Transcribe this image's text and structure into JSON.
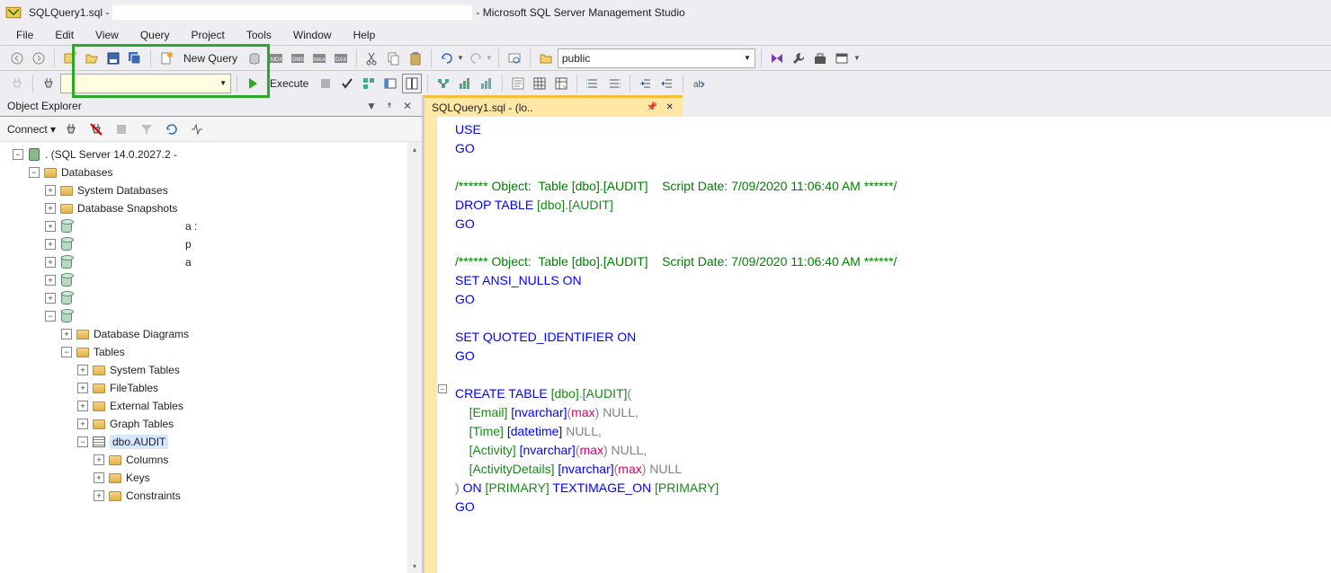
{
  "title": {
    "prefix": "SQLQuery1.sql -",
    "suffix": "- Microsoft SQL Server Management Studio"
  },
  "menu": [
    "File",
    "Edit",
    "View",
    "Query",
    "Project",
    "Tools",
    "Window",
    "Help"
  ],
  "toolbar1": {
    "new_query": "New Query",
    "combo_value": "public"
  },
  "toolbar2": {
    "execute": "Execute"
  },
  "oe": {
    "title": "Object Explorer",
    "connect": "Connect",
    "tree": {
      "server": ". (SQL Server 14.0.2027.2 -",
      "databases": "Databases",
      "sysdb": "System Databases",
      "snapshots": "Database Snapshots",
      "obscured": [
        "a :",
        "p",
        "a"
      ],
      "diagrams": "Database Diagrams",
      "tables": "Tables",
      "systables": "System Tables",
      "filetables": "FileTables",
      "exttables": "External Tables",
      "graphtables": "Graph Tables",
      "dboaudit": "dbo.AUDIT",
      "columns": "Columns",
      "keys": "Keys",
      "constraints": "Constraints"
    }
  },
  "tab": {
    "label": "SQLQuery1.sql - (lo.."
  },
  "code": {
    "lines": [
      {
        "t": "USE",
        "cls": "kw"
      },
      {
        "t": "GO",
        "cls": "kw"
      },
      {
        "t": ""
      },
      {
        "segments": [
          {
            "t": "/****** Object:  Table [dbo].[AUDIT]    Script Date: 7/09/2020 11:06:40 AM ******/",
            "cls": "cm"
          }
        ]
      },
      {
        "segments": [
          {
            "t": "DROP",
            "cls": "kw"
          },
          {
            "t": " "
          },
          {
            "t": "TABLE",
            "cls": "kw"
          },
          {
            "t": " "
          },
          {
            "t": "[dbo]",
            "cls": "tk"
          },
          {
            "t": ".",
            "cls": "gr"
          },
          {
            "t": "[AUDIT]",
            "cls": "tk"
          }
        ]
      },
      {
        "t": "GO",
        "cls": "kw"
      },
      {
        "t": ""
      },
      {
        "segments": [
          {
            "t": "/****** Object:  Table [dbo].[AUDIT]    Script Date: 7/09/2020 11:06:40 AM ******/",
            "cls": "cm"
          }
        ]
      },
      {
        "segments": [
          {
            "t": "SET",
            "cls": "kw"
          },
          {
            "t": " "
          },
          {
            "t": "ANSI_NULLS",
            "cls": "kw"
          },
          {
            "t": " "
          },
          {
            "t": "ON",
            "cls": "kw"
          }
        ]
      },
      {
        "t": "GO",
        "cls": "kw"
      },
      {
        "t": ""
      },
      {
        "segments": [
          {
            "t": "SET",
            "cls": "kw"
          },
          {
            "t": " "
          },
          {
            "t": "QUOTED_IDENTIFIER",
            "cls": "kw"
          },
          {
            "t": " "
          },
          {
            "t": "ON",
            "cls": "kw"
          }
        ]
      },
      {
        "t": "GO",
        "cls": "kw"
      },
      {
        "t": ""
      },
      {
        "segments": [
          {
            "t": "CREATE",
            "cls": "kw"
          },
          {
            "t": " "
          },
          {
            "t": "TABLE",
            "cls": "kw"
          },
          {
            "t": " "
          },
          {
            "t": "[dbo]",
            "cls": "tk"
          },
          {
            "t": ".",
            "cls": "gr"
          },
          {
            "t": "[AUDIT]",
            "cls": "tk"
          },
          {
            "t": "(",
            "cls": "gr"
          }
        ]
      },
      {
        "segments": [
          {
            "t": "    "
          },
          {
            "t": "[Email]",
            "cls": "tk"
          },
          {
            "t": " "
          },
          {
            "t": "[nvarchar]",
            "cls": "kw"
          },
          {
            "t": "(",
            "cls": "gr"
          },
          {
            "t": "max",
            "cls": "fn"
          },
          {
            "t": ")",
            "cls": "gr"
          },
          {
            "t": " "
          },
          {
            "t": "NULL",
            "cls": "gr"
          },
          {
            "t": ",",
            "cls": "gr"
          }
        ]
      },
      {
        "segments": [
          {
            "t": "    "
          },
          {
            "t": "[Time]",
            "cls": "tk"
          },
          {
            "t": " "
          },
          {
            "t": "[datetime]",
            "cls": "kw"
          },
          {
            "t": " "
          },
          {
            "t": "NULL",
            "cls": "gr"
          },
          {
            "t": ",",
            "cls": "gr"
          }
        ]
      },
      {
        "segments": [
          {
            "t": "    "
          },
          {
            "t": "[Activity]",
            "cls": "tk"
          },
          {
            "t": " "
          },
          {
            "t": "[nvarchar]",
            "cls": "kw"
          },
          {
            "t": "(",
            "cls": "gr"
          },
          {
            "t": "max",
            "cls": "fn"
          },
          {
            "t": ")",
            "cls": "gr"
          },
          {
            "t": " "
          },
          {
            "t": "NULL",
            "cls": "gr"
          },
          {
            "t": ",",
            "cls": "gr"
          }
        ]
      },
      {
        "segments": [
          {
            "t": "    "
          },
          {
            "t": "[ActivityDetails]",
            "cls": "tk"
          },
          {
            "t": " "
          },
          {
            "t": "[nvarchar]",
            "cls": "kw"
          },
          {
            "t": "(",
            "cls": "gr"
          },
          {
            "t": "max",
            "cls": "fn"
          },
          {
            "t": ")",
            "cls": "gr"
          },
          {
            "t": " "
          },
          {
            "t": "NULL",
            "cls": "gr"
          }
        ]
      },
      {
        "segments": [
          {
            "t": ")",
            "cls": "gr"
          },
          {
            "t": " "
          },
          {
            "t": "ON",
            "cls": "kw"
          },
          {
            "t": " "
          },
          {
            "t": "[PRIMARY]",
            "cls": "tk"
          },
          {
            "t": " "
          },
          {
            "t": "TEXTIMAGE_ON",
            "cls": "kw"
          },
          {
            "t": " "
          },
          {
            "t": "[PRIMARY]",
            "cls": "tk"
          }
        ]
      },
      {
        "t": "GO",
        "cls": "kw"
      }
    ]
  }
}
